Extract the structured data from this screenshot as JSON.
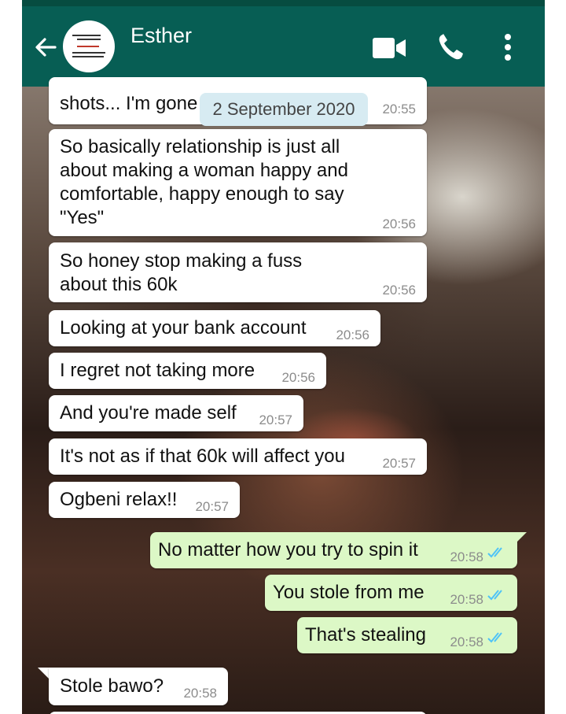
{
  "header": {
    "contact_name": "Esther",
    "back_icon": "arrow-left-icon",
    "video_icon": "video-camera-icon",
    "call_icon": "phone-icon",
    "menu_icon": "more-vertical-icon",
    "colors": {
      "bar": "#075e54",
      "status": "#064c40"
    }
  },
  "date_chip": "2 September 2020",
  "messages": [
    {
      "text": "shots... I'm gone",
      "time": "20:55",
      "dir": "in"
    },
    {
      "lines": [
        "So basically relationship is just all",
        "about making a woman happy and",
        "comfortable, happy enough to say",
        "\"Yes\""
      ],
      "time": "20:56",
      "dir": "in"
    },
    {
      "lines": [
        "So honey stop making a fuss",
        "about this 60k"
      ],
      "time": "20:56",
      "dir": "in"
    },
    {
      "text": "Looking at your bank account",
      "time": "20:56",
      "dir": "in"
    },
    {
      "text": "I regret not taking more",
      "time": "20:56",
      "dir": "in"
    },
    {
      "text": "And you're made self",
      "time": "20:57",
      "dir": "in"
    },
    {
      "text": "It's not as if that 60k will affect you",
      "time": "20:57",
      "dir": "in"
    },
    {
      "text": "Ogbeni relax!!",
      "time": "20:57",
      "dir": "in"
    },
    {
      "text": "No matter how you try to spin it",
      "time": "20:58",
      "dir": "out",
      "read": true
    },
    {
      "text": "You stole from me",
      "time": "20:58",
      "dir": "out",
      "read": true
    },
    {
      "text": "That's stealing",
      "time": "20:58",
      "dir": "out",
      "read": true
    },
    {
      "text": "Stole bawo?",
      "time": "20:58",
      "dir": "in"
    }
  ],
  "colors": {
    "incoming": "#ffffff",
    "outgoing": "#dcf8c6",
    "read_ticks": "#4fc3f7"
  }
}
